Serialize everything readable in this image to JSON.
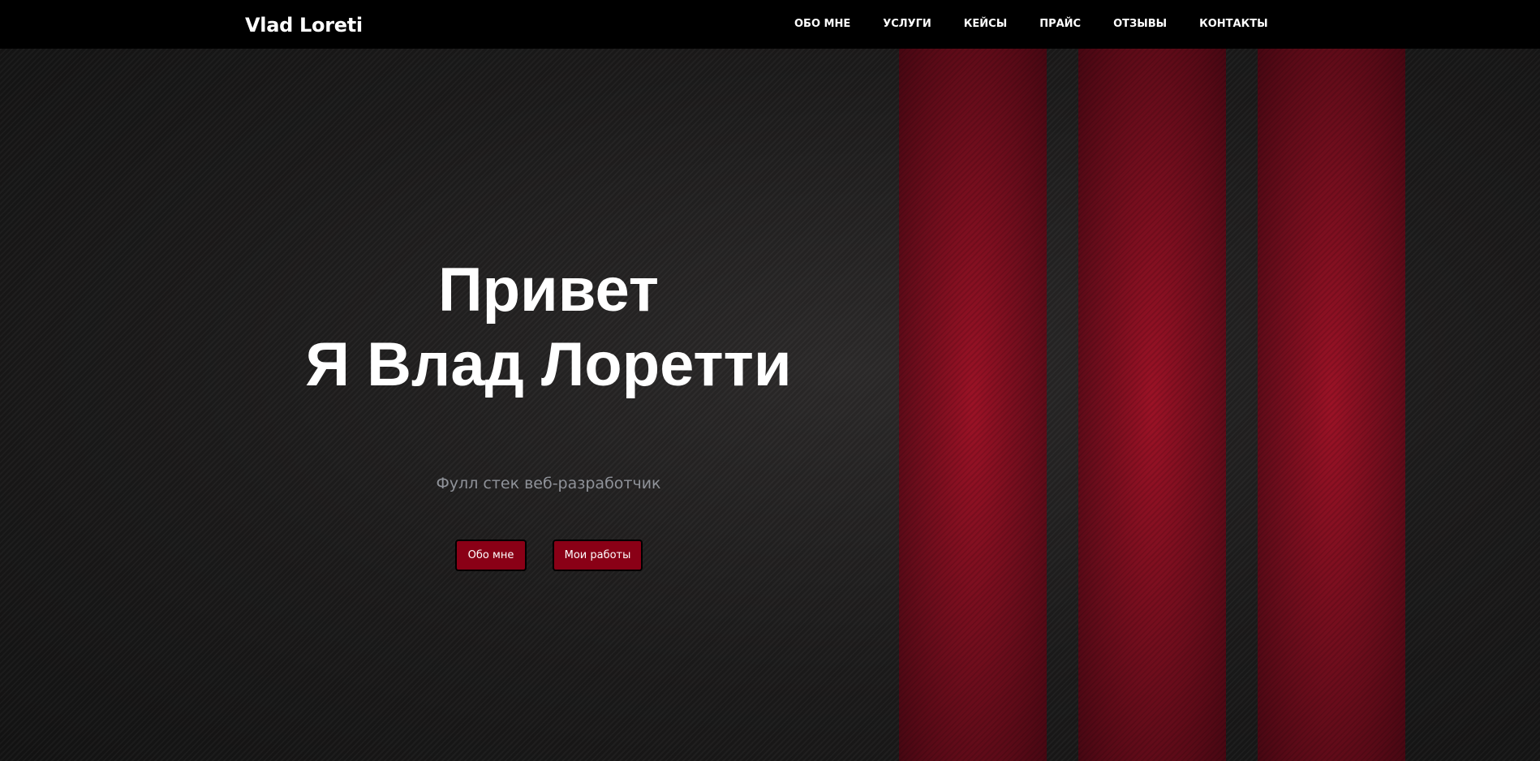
{
  "header": {
    "logo": "Vlad Loreti",
    "nav": [
      {
        "label": "ОБО МНЕ"
      },
      {
        "label": "УСЛУГИ"
      },
      {
        "label": "КЕЙСЫ"
      },
      {
        "label": "ПРАЙС"
      },
      {
        "label": "ОТЗЫВЫ"
      },
      {
        "label": "КОНТАКТЫ"
      }
    ]
  },
  "hero": {
    "title_line1": "Привет",
    "title_line2": "Я Влад Лоретти",
    "subtitle": "Фулл стек веб-разработчик",
    "buttons": {
      "about": "Обо мне",
      "works": "Мои работы"
    }
  },
  "colors": {
    "header_bg": "#000000",
    "accent_red": "#8a0016",
    "stripe_red": "#9c1226",
    "text_muted": "#8f9299"
  }
}
